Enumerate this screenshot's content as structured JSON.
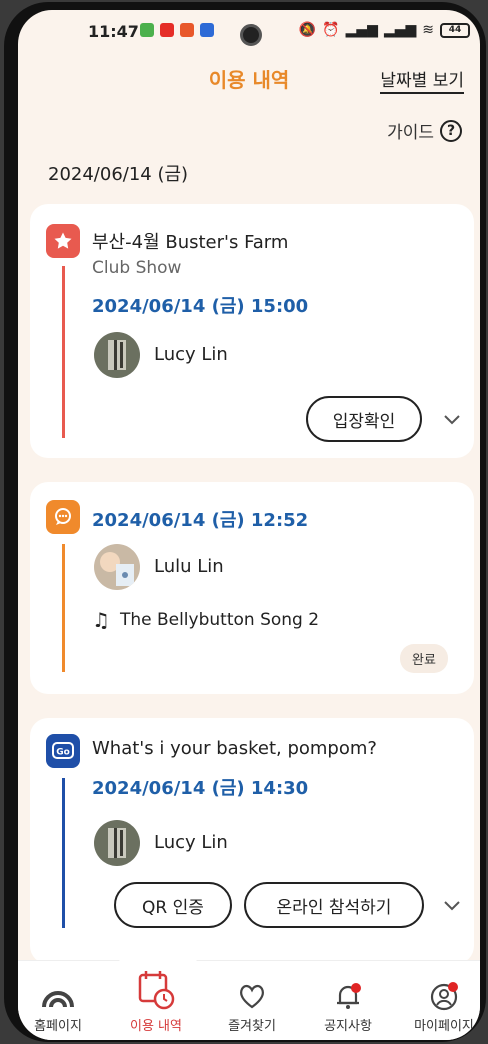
{
  "status_bar": {
    "time": "11:47",
    "battery": "44"
  },
  "header": {
    "title": "이용 내역",
    "date_view_link": "날짜별 보기"
  },
  "guide": {
    "label": "가이드",
    "icon": "?"
  },
  "date_heading": "2024/06/14 (금)",
  "cards": [
    {
      "icon": "star-icon",
      "accent": "#e85a4f",
      "title": "부산-4월 Buster's Farm",
      "subtitle": "Club Show",
      "datetime": "2024/06/14 (금) 15:00",
      "person": "Lucy Lin",
      "button": "입장확인"
    },
    {
      "icon": "chat-bubble-icon",
      "accent": "#f08a2c",
      "datetime": "2024/06/14 (금)  12:52",
      "person": "Lulu Lin",
      "song": "The Bellybutton Song 2",
      "status": "완료"
    },
    {
      "icon": "go-icon",
      "accent": "#1f4fa8",
      "title": "What's i your basket, pompom?",
      "datetime": "2024/06/14 (금)  14:30",
      "person": "Lucy Lin",
      "buttons": [
        "QR 인증",
        "온라인 참석하기"
      ]
    }
  ],
  "bottom_nav": [
    {
      "label": "홈페이지",
      "icon": "home-arch-icon",
      "active": false
    },
    {
      "label": "이용 내역",
      "icon": "calendar-clock-icon",
      "active": true
    },
    {
      "label": "즐겨찾기",
      "icon": "heart-icon",
      "active": false
    },
    {
      "label": "공지사항",
      "icon": "bell-icon",
      "active": false
    },
    {
      "label": "마이페이지",
      "icon": "profile-icon",
      "active": false
    }
  ],
  "colors": {
    "accent": "#e8892a",
    "date_blue": "#1f5fa8",
    "background": "#fbf3ec"
  }
}
